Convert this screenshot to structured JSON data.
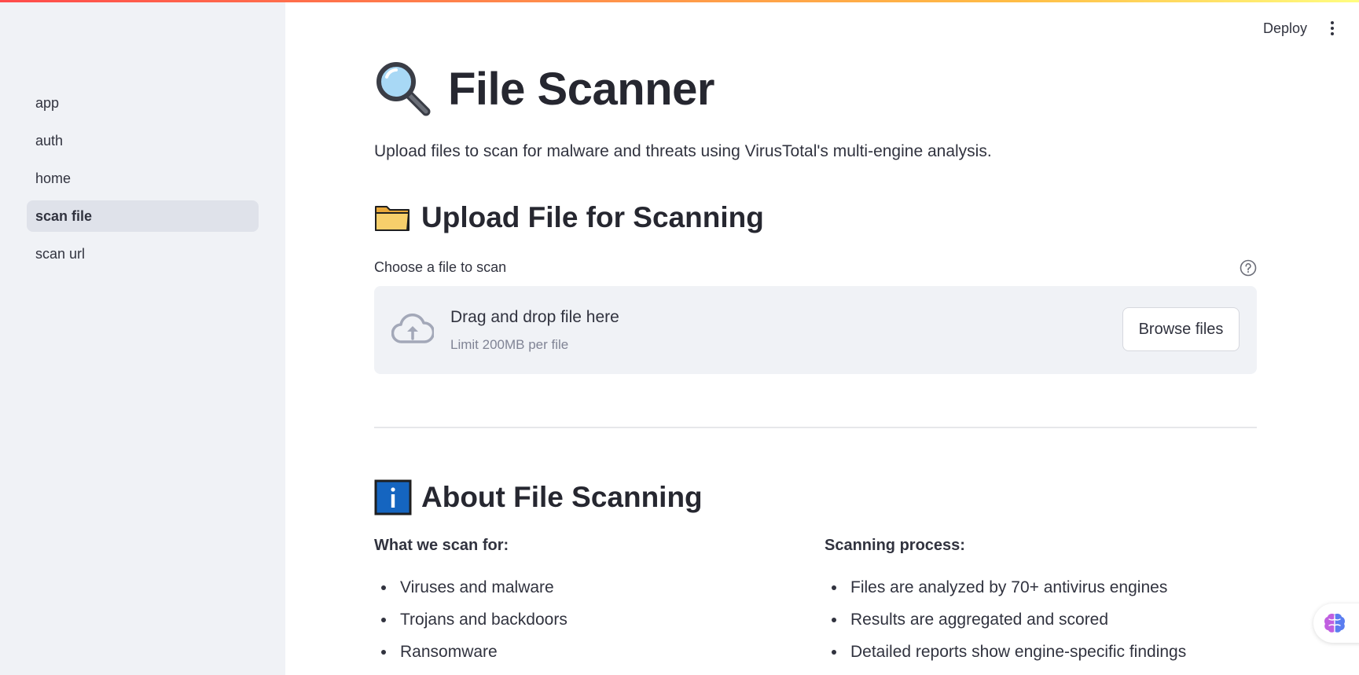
{
  "sidebar": {
    "items": [
      {
        "label": "app"
      },
      {
        "label": "auth"
      },
      {
        "label": "home"
      },
      {
        "label": "scan file",
        "active": true
      },
      {
        "label": "scan url"
      }
    ]
  },
  "header": {
    "deploy_label": "Deploy",
    "menu_icon": "kebab-menu-icon"
  },
  "page": {
    "title": "File Scanner",
    "title_icon": "magnifying-glass-icon",
    "intro": "Upload files to scan for malware and threats using VirusTotal's multi-engine analysis."
  },
  "upload": {
    "heading": "Upload File for Scanning",
    "heading_icon": "folder-icon",
    "label": "Choose a file to scan",
    "help_icon": "help-circle-icon",
    "dropzone_title": "Drag and drop file here",
    "dropzone_limit": "Limit 200MB per file",
    "browse_label": "Browse files",
    "cloud_icon": "cloud-upload-icon"
  },
  "about": {
    "heading": "About File Scanning",
    "heading_icon": "info-icon",
    "left_title": "What we scan for:",
    "left_items": [
      "Viruses and malware",
      "Trojans and backdoors",
      "Ransomware"
    ],
    "right_title": "Scanning process:",
    "right_items": [
      "Files are analyzed by 70+ antivirus engines",
      "Results are aggregated and scored",
      "Detailed reports show engine-specific findings"
    ]
  },
  "colors": {
    "sidebar_bg": "#f0f2f6",
    "text": "#31333f",
    "info_blue": "#1565c0"
  }
}
